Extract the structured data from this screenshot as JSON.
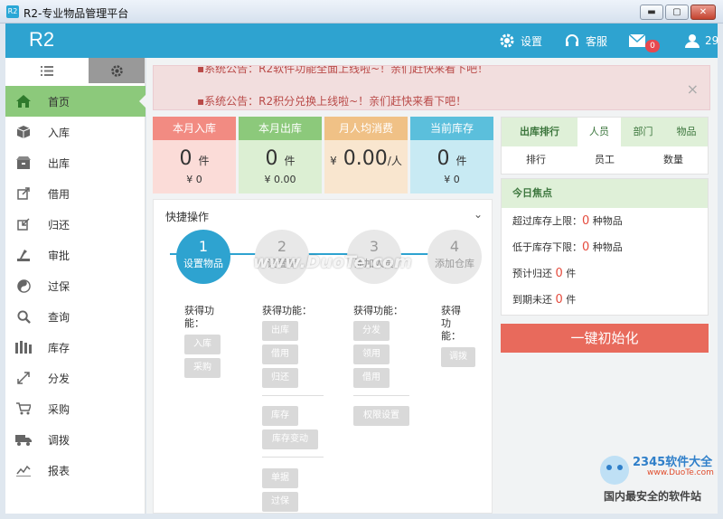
{
  "window": {
    "app_icon": "R2",
    "title": "R2-专业物品管理平台"
  },
  "header": {
    "logo": "R2",
    "settings_label": "设置",
    "service_label": "客服",
    "mail_count": "0",
    "user_label": "29"
  },
  "sidebar": {
    "items": [
      {
        "label": "首页",
        "icon": "home-icon"
      },
      {
        "label": "入库",
        "icon": "box-in-icon"
      },
      {
        "label": "出库",
        "icon": "box-out-icon"
      },
      {
        "label": "借用",
        "icon": "borrow-icon"
      },
      {
        "label": "归还",
        "icon": "return-icon"
      },
      {
        "label": "审批",
        "icon": "approve-icon"
      },
      {
        "label": "过保",
        "icon": "warranty-icon"
      },
      {
        "label": "查询",
        "icon": "search-icon"
      },
      {
        "label": "库存",
        "icon": "stock-icon"
      },
      {
        "label": "分发",
        "icon": "distribute-icon"
      },
      {
        "label": "采购",
        "icon": "cart-icon"
      },
      {
        "label": "调拨",
        "icon": "truck-icon"
      },
      {
        "label": "报表",
        "icon": "chart-icon"
      }
    ]
  },
  "notice": {
    "line1": "▪系统公告：R2软件功能全面上线啦~！亲们赶快来看下吧！",
    "line2": "▪系统公告：R2积分兑换上线啦~！亲们赶快来看下吧！",
    "close": "×"
  },
  "stats": [
    {
      "title": "本月入库",
      "value": "0",
      "unit": "件",
      "sub": "¥ 0",
      "color": "#f28b82",
      "bg": "#fbdcd8"
    },
    {
      "title": "本月出库",
      "value": "0",
      "unit": "件",
      "sub": "¥ 0.00",
      "color": "#8cc97b",
      "bg": "#dcefd3"
    },
    {
      "title": "月人均消费",
      "value": "0.00",
      "unit": "/人",
      "prefix": "¥",
      "sub": "",
      "color": "#f0c186",
      "bg": "#f9e6cf"
    },
    {
      "title": "当前库存",
      "value": "0",
      "unit": "件",
      "sub": "¥ 0",
      "color": "#5bbfdc",
      "bg": "#c8eaf3"
    }
  ],
  "quick": {
    "title": "快捷操作",
    "steps": [
      {
        "num": "1",
        "label": "设置物品"
      },
      {
        "num": "2",
        "label": "设置库"
      },
      {
        "num": "3",
        "label": "添加人员"
      },
      {
        "num": "4",
        "label": "添加仓库"
      }
    ],
    "func_label": "获得功能：",
    "col1": [
      "入库",
      "采购"
    ],
    "col2a": [
      "出库",
      "借用",
      "归还"
    ],
    "col2b": [
      "库存",
      "库存变动"
    ],
    "col2c": [
      "单据",
      "过保"
    ],
    "col3a": [
      "分发",
      "领用",
      "借用"
    ],
    "col3b": [
      "权限设置"
    ],
    "col4": [
      "调拨"
    ]
  },
  "ranking": {
    "title": "出库排行",
    "tabs": [
      "人员",
      "部门",
      "物品"
    ],
    "columns": [
      "排行",
      "员工",
      "数量"
    ]
  },
  "focus": {
    "title": "今日焦点",
    "rows": [
      {
        "pre": "超过库存上限：",
        "num": "0",
        "post": "种物品"
      },
      {
        "pre": "低于库存下限：",
        "num": "0",
        "post": "种物品"
      },
      {
        "pre": "预计归还",
        "num": "0",
        "post": "件"
      },
      {
        "pre": "到期未还",
        "num": "0",
        "post": "件"
      }
    ]
  },
  "init_button": "一键初始化",
  "watermark": {
    "center": "www.DuoTe.com",
    "brand": "2345软件大全",
    "url": "www.DuoTe.com",
    "slogan": "国内最安全的软件站"
  }
}
